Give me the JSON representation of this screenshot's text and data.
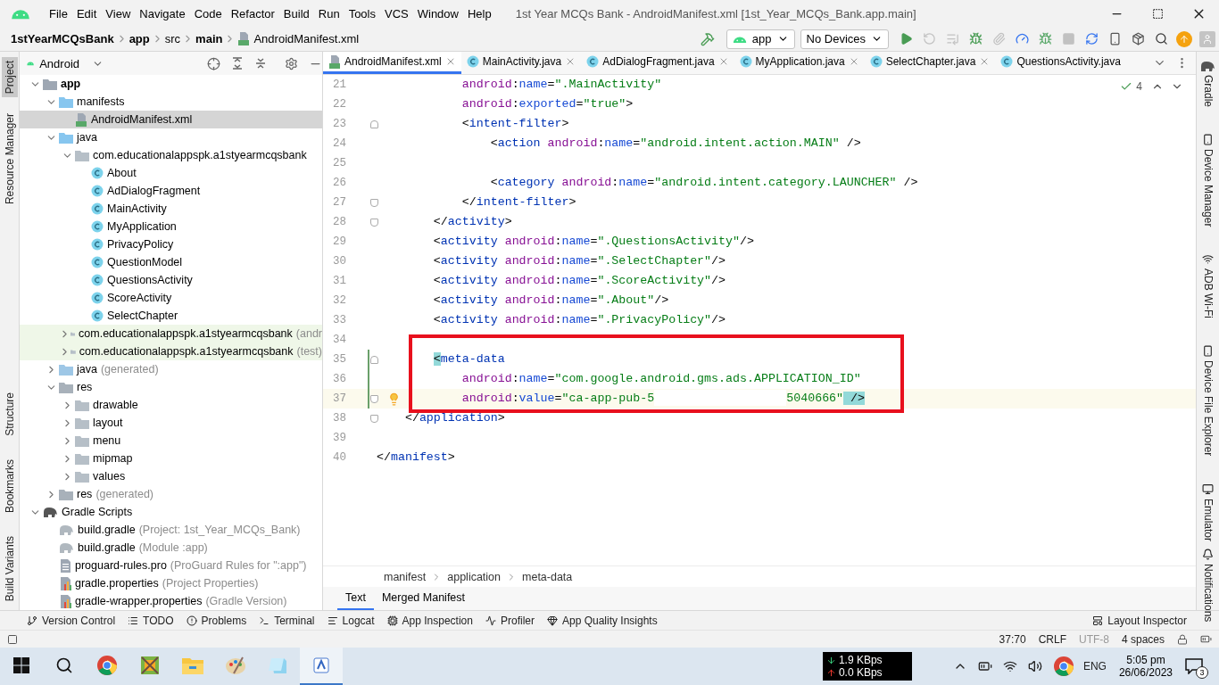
{
  "window": {
    "title": "1st Year MCQs Bank - AndroidManifest.xml [1st_Year_MCQs_Bank.app.main]"
  },
  "menu": [
    "File",
    "Edit",
    "View",
    "Navigate",
    "Code",
    "Refactor",
    "Build",
    "Run",
    "Tools",
    "VCS",
    "Window",
    "Help"
  ],
  "breadcrumbs": [
    {
      "label": "1stYearMCQsBank",
      "bold": true
    },
    {
      "label": "app",
      "bold": true
    },
    {
      "label": "src",
      "bold": false
    },
    {
      "label": "main",
      "bold": true
    },
    {
      "label": "AndroidManifest.xml",
      "bold": false,
      "file": true
    }
  ],
  "toolbar": {
    "configuration": "app",
    "device": "No Devices",
    "actions": [
      {
        "kind": "run",
        "disabled": false
      },
      {
        "kind": "reapply",
        "disabled": true
      },
      {
        "kind": "apply",
        "disabled": true
      },
      {
        "kind": "debug",
        "disabled": false
      },
      {
        "kind": "attach",
        "disabled": true
      },
      {
        "kind": "profile",
        "disabled": false
      },
      {
        "kind": "debug-attach",
        "disabled": false
      },
      {
        "kind": "stop",
        "disabled": true
      },
      {
        "kind": "sync",
        "disabled": false
      },
      {
        "kind": "device",
        "disabled": false
      },
      {
        "kind": "sdk",
        "disabled": false
      },
      {
        "kind": "search",
        "disabled": false
      },
      {
        "kind": "update",
        "disabled": false
      },
      {
        "kind": "account",
        "disabled": false
      }
    ]
  },
  "left_strip": {
    "top": [
      {
        "label": "Project",
        "selected": true
      },
      {
        "label": "Resource Manager",
        "selected": false
      }
    ],
    "bottom": [
      {
        "label": "Structure",
        "selected": false
      },
      {
        "label": "Bookmarks",
        "selected": false
      },
      {
        "label": "Build Variants",
        "selected": false
      }
    ]
  },
  "right_strip": {
    "top": [
      {
        "label": "Gradle",
        "kind": "gradle"
      },
      {
        "label": "Device Manager",
        "kind": "device"
      },
      {
        "label": "ADB Wi-Fi",
        "kind": "wifi"
      },
      {
        "label": "Device File Explorer",
        "kind": "device"
      },
      {
        "label": "Emulator",
        "kind": "emulator"
      }
    ],
    "bottom": [
      {
        "label": "Notifications",
        "kind": "bell"
      }
    ]
  },
  "project_panel": {
    "view": "Android",
    "tree": [
      {
        "kind": "module",
        "label": "app",
        "expanded": true,
        "selected": false,
        "children": [
          {
            "kind": "folder",
            "label": "manifests",
            "expanded": true,
            "selected": false,
            "children": [
              {
                "kind": "manifest",
                "label": "AndroidManifest.xml",
                "selected": true
              }
            ]
          },
          {
            "kind": "folder",
            "label": "java",
            "expanded": true,
            "selected": false,
            "children": [
              {
                "kind": "package",
                "label": "com.educationalappspk.a1styearmcqsbank",
                "expanded": true,
                "selected": false,
                "children": [
                  {
                    "kind": "class",
                    "label": "About",
                    "selected": false
                  },
                  {
                    "kind": "class",
                    "label": "AdDialogFragment",
                    "selected": false
                  },
                  {
                    "kind": "class",
                    "label": "MainActivity",
                    "selected": false
                  },
                  {
                    "kind": "class",
                    "label": "MyApplication",
                    "selected": false
                  },
                  {
                    "kind": "class",
                    "label": "PrivacyPolicy",
                    "selected": false
                  },
                  {
                    "kind": "class",
                    "label": "QuestionModel",
                    "selected": false
                  },
                  {
                    "kind": "class",
                    "label": "QuestionsActivity",
                    "selected": false
                  },
                  {
                    "kind": "class",
                    "label": "ScoreActivity",
                    "selected": false
                  },
                  {
                    "kind": "class",
                    "label": "SelectChapter",
                    "selected": false
                  }
                ]
              },
              {
                "kind": "test-package",
                "label": "com.educationalappspk.a1styearmcqsbank",
                "note": "(andr",
                "expanded": false,
                "selected": false
              },
              {
                "kind": "test-package",
                "label": "com.educationalappspk.a1styearmcqsbank",
                "note": "(test)",
                "expanded": false,
                "selected": false
              }
            ]
          },
          {
            "kind": "generated",
            "label": "java",
            "note": "(generated)",
            "expanded": false,
            "selected": false
          },
          {
            "kind": "res",
            "label": "res",
            "expanded": true,
            "selected": false,
            "children": [
              {
                "kind": "package",
                "label": "drawable",
                "expanded": false,
                "selected": false
              },
              {
                "kind": "package",
                "label": "layout",
                "expanded": false,
                "selected": false
              },
              {
                "kind": "package",
                "label": "menu",
                "expanded": false,
                "selected": false
              },
              {
                "kind": "package",
                "label": "mipmap",
                "expanded": false,
                "selected": false
              },
              {
                "kind": "package",
                "label": "values",
                "expanded": false,
                "selected": false
              }
            ]
          },
          {
            "kind": "res",
            "label": "res",
            "note": "(generated)",
            "expanded": false,
            "selected": false
          }
        ]
      },
      {
        "kind": "gradle-root",
        "label": "Gradle Scripts",
        "expanded": true,
        "selected": false,
        "children": [
          {
            "kind": "gradle",
            "label": "build.gradle",
            "note": "(Project: 1st_Year_MCQs_Bank)",
            "selected": false
          },
          {
            "kind": "gradle",
            "label": "build.gradle",
            "note": "(Module :app)",
            "selected": false
          },
          {
            "kind": "pro",
            "label": "proguard-rules.pro",
            "note": "(ProGuard Rules for \":app\")",
            "selected": false
          },
          {
            "kind": "properties",
            "label": "gradle.properties",
            "note": "(Project Properties)",
            "selected": false
          },
          {
            "kind": "properties",
            "label": "gradle-wrapper.properties",
            "note": "(Gradle Version)",
            "selected": false
          }
        ]
      }
    ]
  },
  "editor": {
    "tabs": [
      {
        "label": "AndroidManifest.xml",
        "kind": "manifest",
        "selected": true,
        "closable": true
      },
      {
        "label": "MainActivity.java",
        "kind": "class",
        "selected": false,
        "closable": true
      },
      {
        "label": "AdDialogFragment.java",
        "kind": "class",
        "selected": false,
        "closable": true
      },
      {
        "label": "MyApplication.java",
        "kind": "class",
        "selected": false,
        "closable": true
      },
      {
        "label": "SelectChapter.java",
        "kind": "class",
        "selected": false,
        "closable": true
      },
      {
        "label": "QuestionsActivity.java",
        "kind": "class",
        "selected": false,
        "closable": false
      }
    ],
    "inspections": "4",
    "lines": [
      {
        "number": "21",
        "tokens": [
          {
            "kind": "ns",
            "text": "            android"
          },
          {
            "kind": "plain",
            "text": ":"
          },
          {
            "kind": "attr",
            "text": "name"
          },
          {
            "kind": "plain",
            "text": "="
          },
          {
            "kind": "str",
            "text": "\".MainActivity\""
          }
        ]
      },
      {
        "number": "22",
        "tokens": [
          {
            "kind": "ns",
            "text": "            android"
          },
          {
            "kind": "plain",
            "text": ":"
          },
          {
            "kind": "attr",
            "text": "exported"
          },
          {
            "kind": "plain",
            "text": "="
          },
          {
            "kind": "str",
            "text": "\"true\""
          },
          {
            "kind": "plain",
            "text": ">"
          }
        ]
      },
      {
        "number": "23",
        "fold_start": true,
        "tokens": [
          {
            "kind": "plain",
            "text": "            <"
          },
          {
            "kind": "tag",
            "text": "intent-filter"
          },
          {
            "kind": "plain",
            "text": ">"
          }
        ]
      },
      {
        "number": "24",
        "tokens": [
          {
            "kind": "plain",
            "text": "                <"
          },
          {
            "kind": "tag",
            "text": "action "
          },
          {
            "kind": "ns",
            "text": "android"
          },
          {
            "kind": "plain",
            "text": ":"
          },
          {
            "kind": "attr",
            "text": "name"
          },
          {
            "kind": "plain",
            "text": "="
          },
          {
            "kind": "str",
            "text": "\"android.intent.action.MAIN\""
          },
          {
            "kind": "plain",
            "text": " />"
          }
        ]
      },
      {
        "number": "25"
      },
      {
        "number": "26",
        "tokens": [
          {
            "kind": "plain",
            "text": "                <"
          },
          {
            "kind": "tag",
            "text": "category "
          },
          {
            "kind": "ns",
            "text": "android"
          },
          {
            "kind": "plain",
            "text": ":"
          },
          {
            "kind": "attr",
            "text": "name"
          },
          {
            "kind": "plain",
            "text": "="
          },
          {
            "kind": "str",
            "text": "\"android.intent.category.LAUNCHER\""
          },
          {
            "kind": "plain",
            "text": " />"
          }
        ]
      },
      {
        "number": "27",
        "fold_end": true,
        "tokens": [
          {
            "kind": "plain",
            "text": "            </"
          },
          {
            "kind": "tag",
            "text": "intent-filter"
          },
          {
            "kind": "plain",
            "text": ">"
          }
        ]
      },
      {
        "number": "28",
        "fold_end": true,
        "tokens": [
          {
            "kind": "plain",
            "text": "        </"
          },
          {
            "kind": "tag",
            "text": "activity"
          },
          {
            "kind": "plain",
            "text": ">"
          }
        ]
      },
      {
        "number": "29",
        "tokens": [
          {
            "kind": "plain",
            "text": "        <"
          },
          {
            "kind": "tag",
            "text": "activity "
          },
          {
            "kind": "ns",
            "text": "android"
          },
          {
            "kind": "plain",
            "text": ":"
          },
          {
            "kind": "attr",
            "text": "name"
          },
          {
            "kind": "plain",
            "text": "="
          },
          {
            "kind": "str",
            "text": "\".QuestionsActivity\""
          },
          {
            "kind": "plain",
            "text": "/>"
          }
        ]
      },
      {
        "number": "30",
        "tokens": [
          {
            "kind": "plain",
            "text": "        <"
          },
          {
            "kind": "tag",
            "text": "activity "
          },
          {
            "kind": "ns",
            "text": "android"
          },
          {
            "kind": "plain",
            "text": ":"
          },
          {
            "kind": "attr",
            "text": "name"
          },
          {
            "kind": "plain",
            "text": "="
          },
          {
            "kind": "str",
            "text": "\".SelectChapter\""
          },
          {
            "kind": "plain",
            "text": "/>"
          }
        ]
      },
      {
        "number": "31",
        "tokens": [
          {
            "kind": "plain",
            "text": "        <"
          },
          {
            "kind": "tag",
            "text": "activity "
          },
          {
            "kind": "ns",
            "text": "android"
          },
          {
            "kind": "plain",
            "text": ":"
          },
          {
            "kind": "attr",
            "text": "name"
          },
          {
            "kind": "plain",
            "text": "="
          },
          {
            "kind": "str",
            "text": "\".ScoreActivity\""
          },
          {
            "kind": "plain",
            "text": "/>"
          }
        ]
      },
      {
        "number": "32",
        "tokens": [
          {
            "kind": "plain",
            "text": "        <"
          },
          {
            "kind": "tag",
            "text": "activity "
          },
          {
            "kind": "ns",
            "text": "android"
          },
          {
            "kind": "plain",
            "text": ":"
          },
          {
            "kind": "attr",
            "text": "name"
          },
          {
            "kind": "plain",
            "text": "="
          },
          {
            "kind": "str",
            "text": "\".About\""
          },
          {
            "kind": "plain",
            "text": "/>"
          }
        ]
      },
      {
        "number": "33",
        "tokens": [
          {
            "kind": "plain",
            "text": "        <"
          },
          {
            "kind": "tag",
            "text": "activity "
          },
          {
            "kind": "ns",
            "text": "android"
          },
          {
            "kind": "plain",
            "text": ":"
          },
          {
            "kind": "attr",
            "text": "name"
          },
          {
            "kind": "plain",
            "text": "="
          },
          {
            "kind": "str",
            "text": "\".PrivacyPolicy\""
          },
          {
            "kind": "plain",
            "text": "/>"
          }
        ]
      },
      {
        "number": "34"
      },
      {
        "number": "35",
        "fold_start": true,
        "changed": true,
        "boxed": true,
        "tokens": [
          {
            "kind": "match",
            "text": "        <"
          },
          {
            "kind": "tag",
            "text": "meta-data"
          }
        ]
      },
      {
        "number": "36",
        "changed": true,
        "boxed": true,
        "tokens": [
          {
            "kind": "ns",
            "text": "            android"
          },
          {
            "kind": "plain",
            "text": ":"
          },
          {
            "kind": "attr",
            "text": "name"
          },
          {
            "kind": "plain",
            "text": "="
          },
          {
            "kind": "str",
            "text": "\"com.google.android.gms.ads.APPLICATION_ID\""
          }
        ]
      },
      {
        "number": "37",
        "fold_end": true,
        "changed": true,
        "boxed": true,
        "caret": true,
        "intention": true,
        "tokens": [
          {
            "kind": "ns",
            "text": "            android"
          },
          {
            "kind": "plain",
            "text": ":"
          },
          {
            "kind": "attr",
            "text": "value"
          },
          {
            "kind": "plain",
            "text": "="
          },
          {
            "kind": "str",
            "text": "\"ca-app-pub-5"
          },
          {
            "kind": "cover"
          },
          {
            "kind": "str",
            "text": "5040666\""
          },
          {
            "kind": "match",
            "text": " />"
          }
        ]
      },
      {
        "number": "38",
        "fold_end": true,
        "tokens": [
          {
            "kind": "plain",
            "text": "    </"
          },
          {
            "kind": "tag",
            "text": "application"
          },
          {
            "kind": "plain",
            "text": ">"
          }
        ]
      },
      {
        "number": "39"
      },
      {
        "number": "40",
        "tokens": [
          {
            "kind": "plain",
            "text": "</"
          },
          {
            "kind": "tag",
            "text": "manifest"
          },
          {
            "kind": "plain",
            "text": ">"
          }
        ]
      }
    ],
    "path": [
      "manifest",
      "application",
      "meta-data"
    ],
    "view_tabs": [
      {
        "label": "Text",
        "selected": true
      },
      {
        "label": "Merged Manifest",
        "selected": false
      }
    ]
  },
  "tool_windows": [
    {
      "label": "Version Control",
      "kind": "vcs"
    },
    {
      "label": "TODO",
      "kind": "todo"
    },
    {
      "label": "Problems",
      "kind": "problems"
    },
    {
      "label": "Terminal",
      "kind": "terminal"
    },
    {
      "label": "Logcat",
      "kind": "logcat"
    },
    {
      "label": "App Inspection",
      "kind": "inspection"
    },
    {
      "label": "Profiler",
      "kind": "profiler"
    },
    {
      "label": "App Quality Insights",
      "kind": "insights"
    }
  ],
  "tool_windows_right": [
    {
      "label": "Layout Inspector",
      "kind": "layout"
    }
  ],
  "status_bar": {
    "position": "37:70",
    "line_separator": "CRLF",
    "encoding": "UTF-8",
    "indent": "4 spaces"
  },
  "taskbar": {
    "apps": [
      {
        "kind": "chrome",
        "selected": false
      },
      {
        "kind": "tool",
        "selected": false
      },
      {
        "kind": "explorer",
        "selected": false
      },
      {
        "kind": "paint",
        "selected": false
      },
      {
        "kind": "notepad",
        "selected": false
      },
      {
        "kind": "studio",
        "selected": true
      }
    ],
    "download": "1.9 KBps",
    "upload": "0.0 KBps",
    "language": "ENG",
    "time": "5:05 pm",
    "date": "26/06/2023",
    "notifications": "3"
  }
}
